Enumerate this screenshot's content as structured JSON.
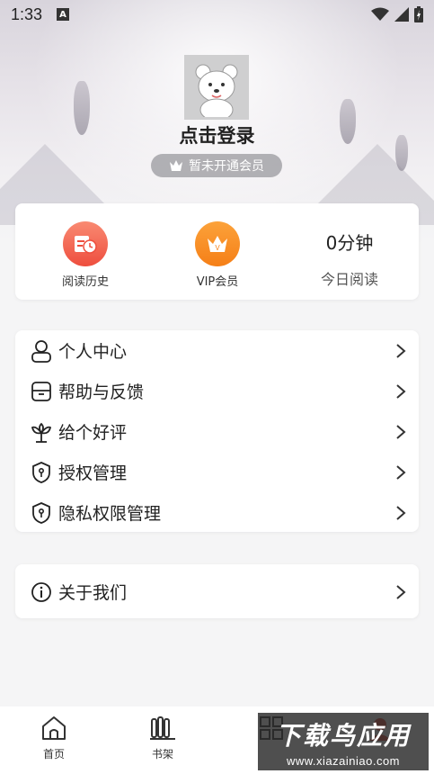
{
  "status_bar": {
    "time": "1:33",
    "notification_icon": "a-icon"
  },
  "profile": {
    "avatar_icon": "bear-avatar-icon",
    "login_text": "点击登录",
    "vip_badge_text": "暂未开通会员"
  },
  "stats": {
    "history_label": "阅读历史",
    "vip_label": "VIP会员",
    "today_value": "0分钟",
    "today_label": "今日阅读",
    "history_color": "#f0624f",
    "vip_color": "#f57f17"
  },
  "menu": {
    "items": [
      {
        "label": "个人中心",
        "icon": "user-icon"
      },
      {
        "label": "帮助与反馈",
        "icon": "feedback-icon"
      },
      {
        "label": "给个好评",
        "icon": "flower-icon"
      },
      {
        "label": "授权管理",
        "icon": "shield-icon"
      },
      {
        "label": "隐私权限管理",
        "icon": "shield-icon"
      }
    ],
    "about_label": "关于我们"
  },
  "tabbar": {
    "tabs": [
      {
        "label": "首页",
        "icon": "home-icon"
      },
      {
        "label": "书架",
        "icon": "bookshelf-icon"
      }
    ]
  },
  "watermark": {
    "main": "下载鸟应用",
    "url": "www.xiazainiao.com"
  }
}
